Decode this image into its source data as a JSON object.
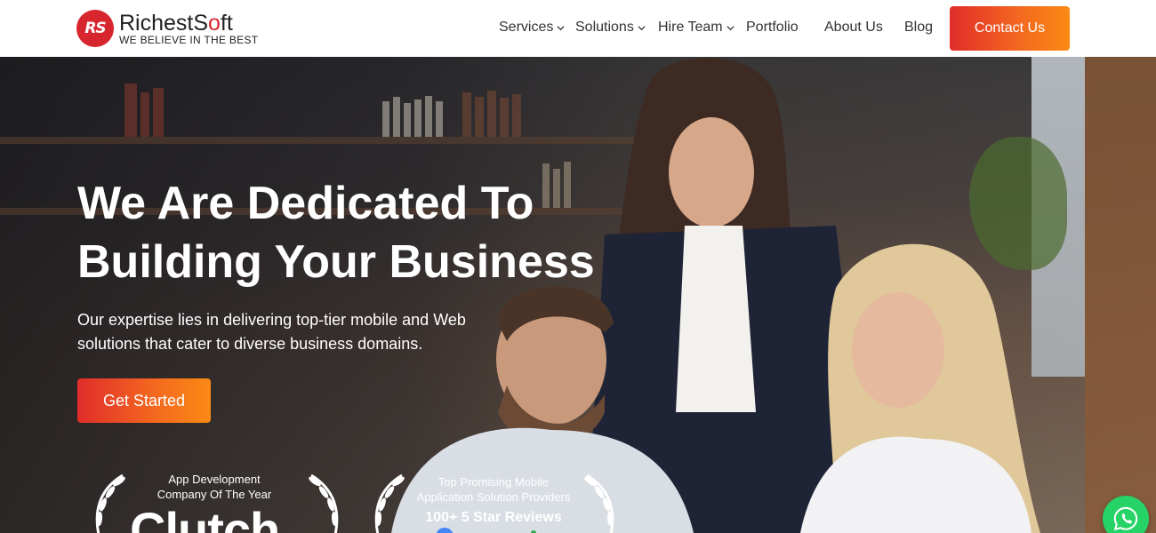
{
  "brand": {
    "logo_mark": "RS",
    "name_part1": "RichestS",
    "name_dot": "o",
    "name_part2": "ft",
    "tagline": "WE BELIEVE IN THE BEST",
    "primary_color": "#d7262e"
  },
  "nav": {
    "items": [
      {
        "label": "Services",
        "has_dropdown": true
      },
      {
        "label": "Solutions",
        "has_dropdown": true
      },
      {
        "label": "Hire Team",
        "has_dropdown": true
      },
      {
        "label": "Portfolio",
        "has_dropdown": false
      },
      {
        "label": "About Us",
        "has_dropdown": false
      },
      {
        "label": "Blog",
        "has_dropdown": false
      }
    ],
    "contact_label": "Contact Us",
    "accent_gradient": [
      "#e12d2a",
      "#fb8a14"
    ]
  },
  "hero": {
    "title_line1": "We Are Dedicated To",
    "title_line2": "Building Your Business",
    "subtitle_line1": "Our expertise lies in delivering top-tier mobile and Web",
    "subtitle_line2": "solutions that cater to diverse business domains.",
    "cta_label": "Get Started"
  },
  "awards": [
    {
      "line1": "App Development",
      "line2": "Company Of The Year",
      "brand_word": "Clutch"
    },
    {
      "line1": "Top Promising Mobile",
      "line2": "Application Solution Providers",
      "highlight": "100+ 5 Star Reviews"
    }
  ],
  "floating": {
    "icon": "whatsapp-icon",
    "color": "#25d366"
  }
}
